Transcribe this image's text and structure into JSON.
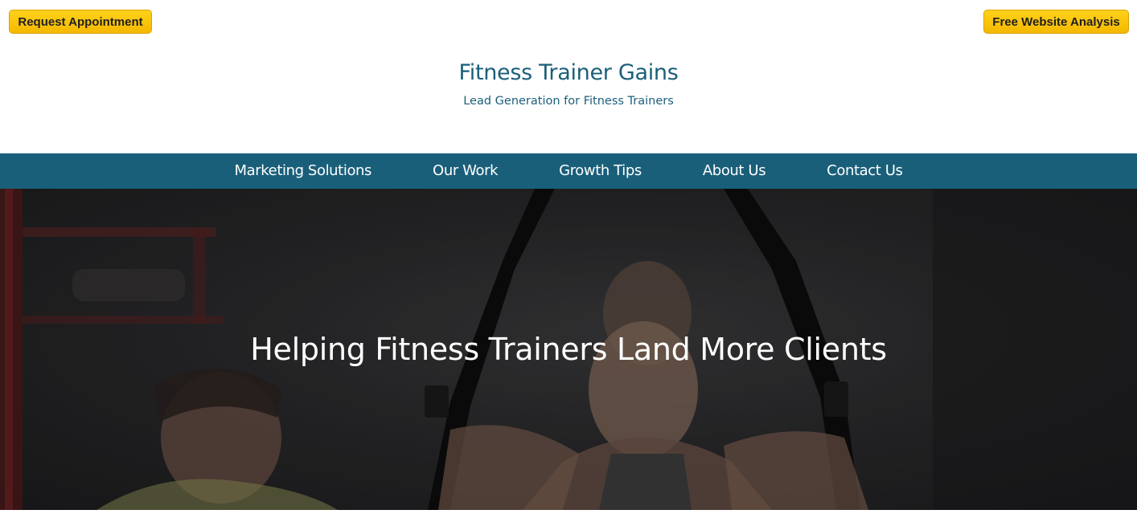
{
  "top_buttons": {
    "left_label": "Request Appointment",
    "right_label": "Free Website Analysis"
  },
  "site": {
    "title": "Fitness Trainer Gains",
    "tagline": "Lead Generation for Fitness Trainers"
  },
  "nav": {
    "items": [
      {
        "label": "Marketing Solutions"
      },
      {
        "label": "Our Work"
      },
      {
        "label": "Growth Tips"
      },
      {
        "label": "About Us"
      },
      {
        "label": "Contact Us"
      }
    ]
  },
  "hero": {
    "heading": "Helping Fitness Trainers Land More Clients"
  },
  "colors": {
    "brand": "#1a5f7a",
    "cta": "#f5b800",
    "hero_dark": "#1c1c1e"
  }
}
